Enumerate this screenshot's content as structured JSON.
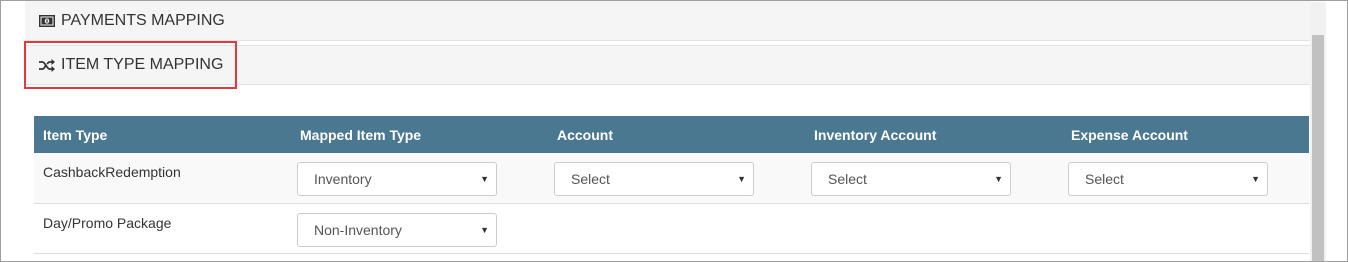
{
  "sections": {
    "payments_title": "PAYMENTS MAPPING",
    "payments_icon": "money-icon",
    "item_type_title": "ITEM TYPE MAPPING",
    "item_type_icon": "random-shuffle-icon"
  },
  "colors": {
    "table_header_bg": "#4a7891",
    "highlight_border": "#e0393e",
    "section_bg": "#f5f5f5"
  },
  "table": {
    "headers": [
      "Item Type",
      "Mapped Item Type",
      "Account",
      "Inventory Account",
      "Expense Account"
    ],
    "rows": [
      {
        "item_type": "CashbackRedemption",
        "mapped_item_type": "Inventory",
        "account": "Select",
        "inventory_account": "Select",
        "expense_account": "Select"
      },
      {
        "item_type": "Day/Promo Package",
        "mapped_item_type": "Non-Inventory"
      }
    ]
  },
  "caret": "▼"
}
